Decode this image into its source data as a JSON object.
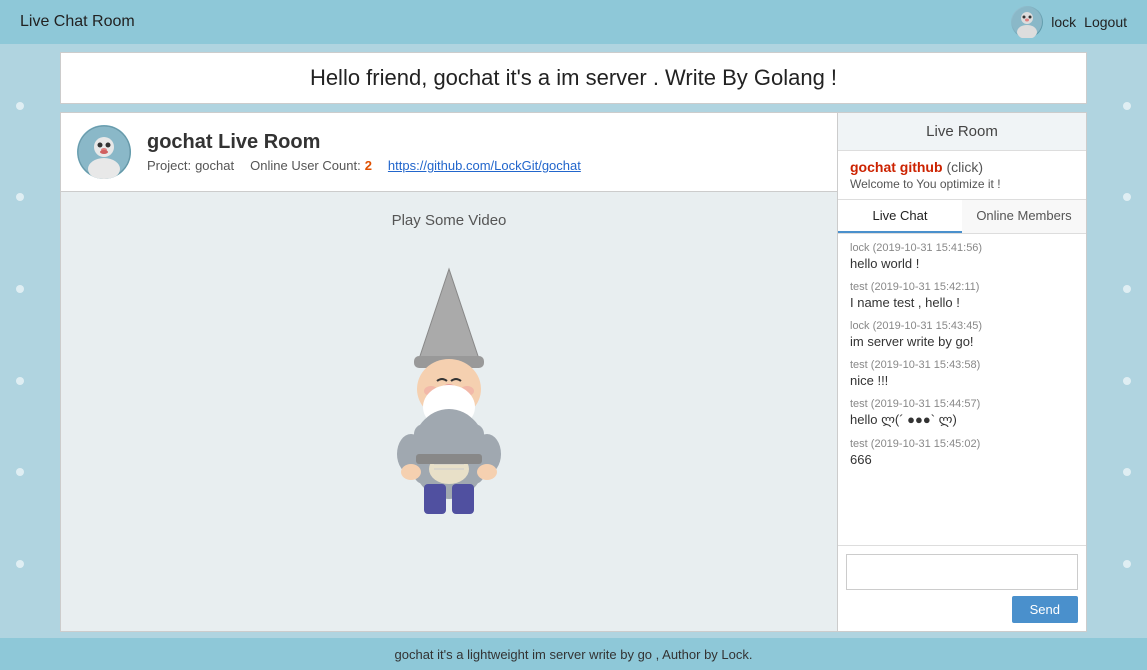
{
  "header": {
    "title": "Live Chat Room",
    "username": "lock",
    "logout_label": "Logout"
  },
  "banner": {
    "text": "Hello friend, gochat it's a im server . Write By Golang !"
  },
  "left_panel": {
    "room_title": "gochat Live Room",
    "project_label": "Project:",
    "project_name": "gochat",
    "online_label": "Online User Count:",
    "online_count": "2",
    "github_url": "https://github.com/LockGit/gochat",
    "play_video_label": "Play Some Video"
  },
  "right_panel": {
    "header": "Live Room",
    "gochat_link_text": "gochat github",
    "gochat_link_suffix": "(click)",
    "welcome_text": "Welcome to You optimize it !",
    "tab_live_chat": "Live Chat",
    "tab_online_members": "Online Members",
    "messages": [
      {
        "meta": "lock (2019-10-31 15:41:56)",
        "text": "hello world !"
      },
      {
        "meta": "test (2019-10-31 15:42:11)",
        "text": "I name test , hello !"
      },
      {
        "meta": "lock (2019-10-31 15:43:45)",
        "text": "im server write by go!"
      },
      {
        "meta": "test (2019-10-31 15:43:58)",
        "text": "nice !!!"
      },
      {
        "meta": "test (2019-10-31 15:44:57)",
        "text": "hello ლ(´ ●●●` ლ)"
      },
      {
        "meta": "test (2019-10-31 15:45:02)",
        "text": "666"
      }
    ],
    "input_placeholder": "",
    "send_label": "Send"
  },
  "footer": {
    "text": "gochat it's a lightweight im server write by go , Author by Lock."
  },
  "dots": {
    "count": 6
  }
}
